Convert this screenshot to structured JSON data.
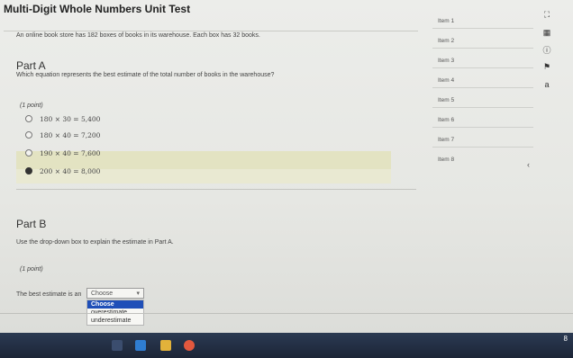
{
  "header": {
    "title": "Multi-Digit Whole Numbers Unit Test"
  },
  "part_a": {
    "question": "An online book store has 182 boxes of books in its warehouse. Each box has 32 books.",
    "heading": "Part A",
    "prompt": "Which equation represents the best estimate of the total number of books in the warehouse?",
    "points": "(1 point)",
    "options": [
      {
        "text": "180 × 30 = 5,400",
        "selected": false
      },
      {
        "text": "180 × 40 = 7,200",
        "selected": false
      },
      {
        "text": "190 × 40 = 7,600",
        "selected": false
      },
      {
        "text": "200 × 40 = 8,000",
        "selected": true
      }
    ]
  },
  "part_b": {
    "heading": "Part B",
    "instruction": "Use the drop-down box to explain the estimate in Part A.",
    "points": "(1 point)",
    "sentence": "The best estimate is an",
    "dropdown": {
      "value": "Choose",
      "options": [
        "Choose",
        "overestimate",
        "underestimate"
      ],
      "highlighted": "Choose"
    }
  },
  "items": [
    "Item 1",
    "Item 2",
    "Item 3",
    "Item 4",
    "Item 5",
    "Item 6",
    "Item 7",
    "Item 8"
  ],
  "side_icons": [
    "fullscreen-icon",
    "calculator-icon",
    "info-icon",
    "flag-icon",
    "text-tool-icon"
  ],
  "taskbar": {
    "time": "8"
  },
  "colors": {
    "highlight": "#1f4fb8",
    "selected_row": "#e3e3c2",
    "taskbar": "#1c2537"
  }
}
